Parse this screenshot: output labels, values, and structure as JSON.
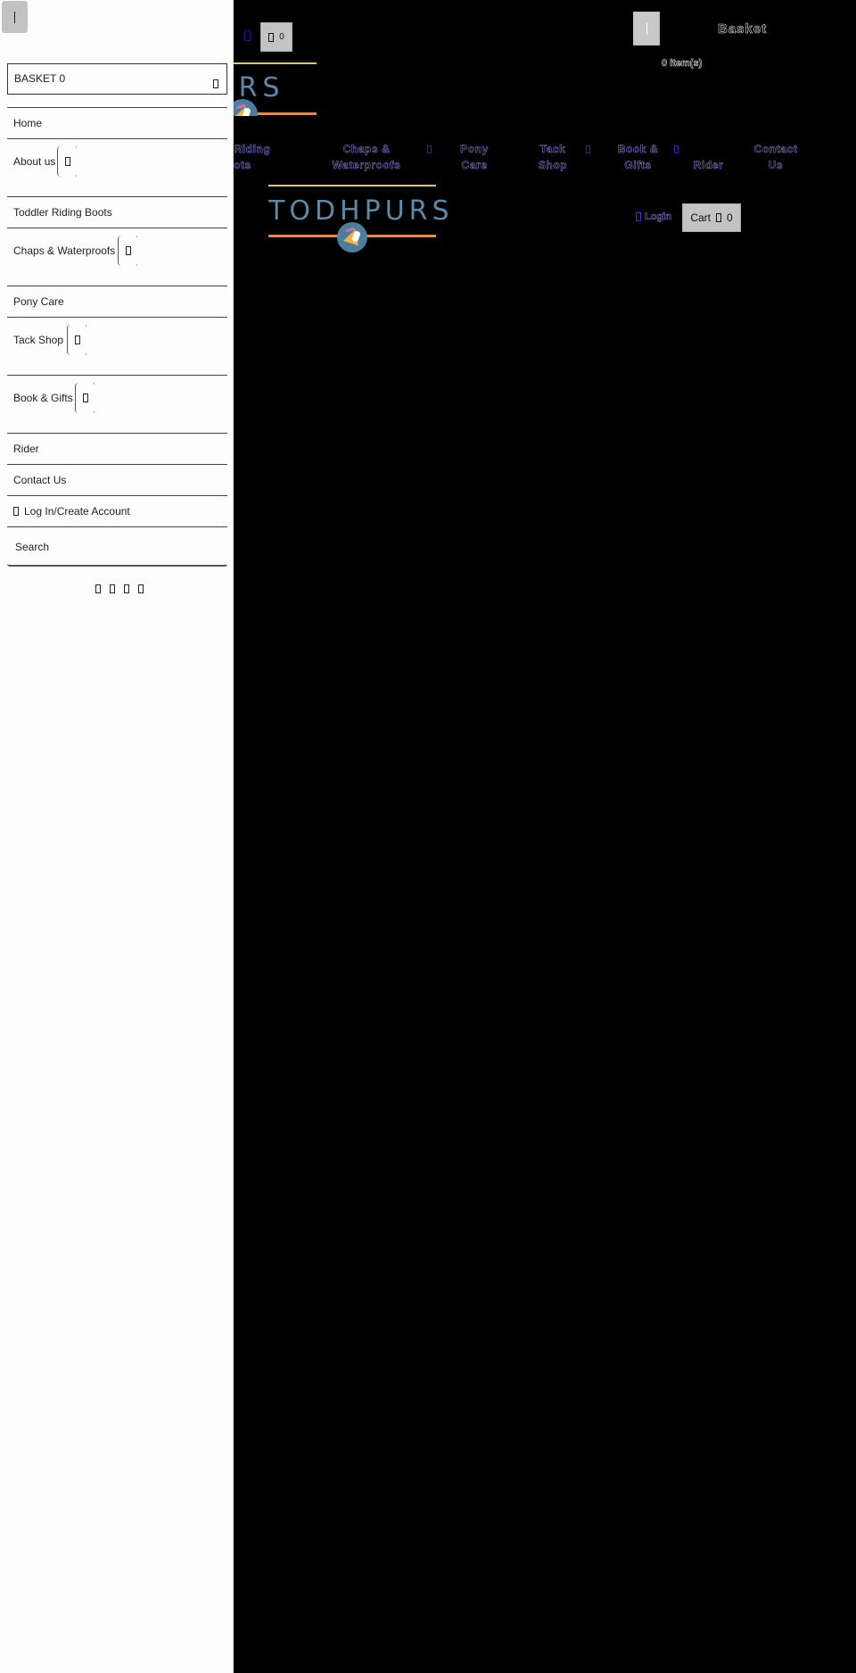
{
  "header": {
    "top_cart_count": "0",
    "basket_heading": "Basket",
    "basket_items": "0 item(s)",
    "logo_text": "TODHPURS",
    "logo_partial_text": "PURS"
  },
  "main_nav": {
    "items": [
      {
        "label": "Riding\nBoots",
        "line1": "Riding",
        "line2": "ots",
        "has_submenu": false
      },
      {
        "label": "Chaps & Waterproofs",
        "line1": "Chaps &",
        "line2": "Waterproofs",
        "has_submenu": true
      },
      {
        "label": "Pony Care",
        "line1": "Pony",
        "line2": "Care",
        "has_submenu": false
      },
      {
        "label": "Tack Shop",
        "line1": "Tack",
        "line2": "Shop",
        "has_submenu": true
      },
      {
        "label": "Book & Gifts",
        "line1": "Book &",
        "line2": "Gifts",
        "has_submenu": true
      },
      {
        "label": "Rider",
        "line1": "",
        "line2": "Rider",
        "has_submenu": false
      },
      {
        "label": "Contact Us",
        "line1": "Contact",
        "line2": "Us",
        "has_submenu": false
      }
    ],
    "login_label": "Login",
    "cart_label": "Cart",
    "cart_count": "0"
  },
  "drawer": {
    "basket_label": "BASKET 0",
    "items": [
      {
        "label": "Home",
        "expandable": false
      },
      {
        "label": "About us",
        "expandable": true
      },
      {
        "label": "Toddler Riding Boots",
        "expandable": false
      },
      {
        "label": "Chaps & Waterproofs",
        "expandable": true
      },
      {
        "label": "Pony Care",
        "expandable": false
      },
      {
        "label": "Tack Shop",
        "expandable": true
      },
      {
        "label": "Book & Gifts",
        "expandable": true
      },
      {
        "label": "Rider",
        "expandable": false
      },
      {
        "label": "Contact Us",
        "expandable": false
      }
    ],
    "account_label": "Log In/Create Account",
    "search_label": "Search",
    "social_icons": [
      "social-icon-1",
      "social-icon-2",
      "social-icon-3",
      "social-icon-4"
    ]
  },
  "colors": {
    "logo_text": "#5d88a6",
    "logo_line_top": "#e6c565",
    "logo_line_bottom": "#e9894a",
    "logo_badge": "#4b7e9c",
    "nav_link": "#8a8ae8",
    "button_gray": "#c3c3c3"
  }
}
